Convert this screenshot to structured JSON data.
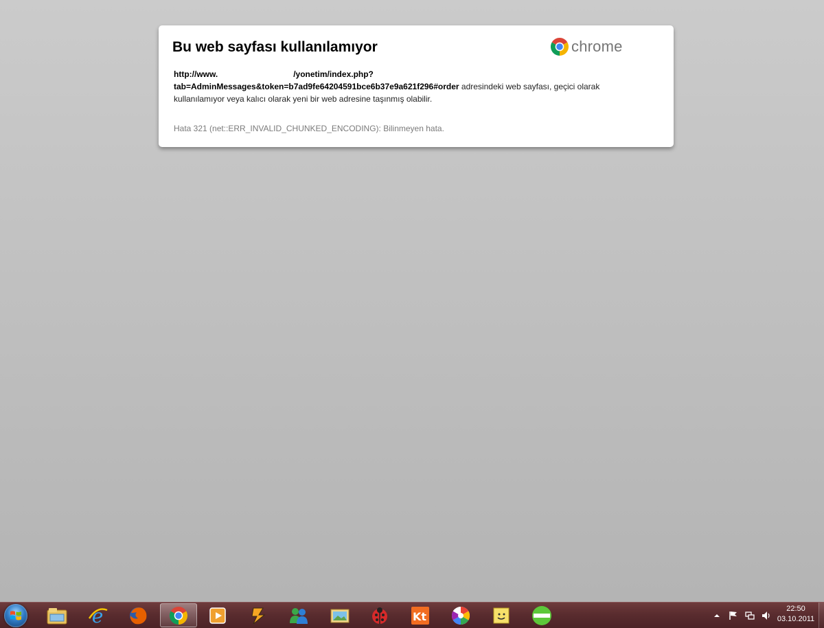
{
  "error_page": {
    "title": "Bu web sayfası kullanılamıyor",
    "brand": "chrome",
    "url_part1": "http://www.",
    "url_part2": "/yonetim/index.php?",
    "url_part3": "tab=AdminMessages&token=b7ad9fe64204591bce6b37e9a621f296#order",
    "message_tail1": " adresindeki web sayfası, geçici olarak",
    "message_tail2": "kullanılamıyor veya kalıcı olarak yeni bir web adresine taşınmış olabilir.",
    "error_code": "Hata 321 (net::ERR_INVALID_CHUNKED_ENCODING): Bilinmeyen hata."
  },
  "taskbar": {
    "pinned": [
      "windows-explorer",
      "internet-explorer",
      "firefox",
      "chrome",
      "media-player",
      "winamp",
      "messenger",
      "photo-viewer",
      "ladybug-app",
      "kt-app",
      "picasa",
      "sticky-notes",
      "green-app"
    ],
    "active": "chrome",
    "tray_icons": [
      "show-hidden-icons",
      "action-center-flag",
      "network",
      "volume"
    ],
    "clock_time": "22:50",
    "clock_date": "03.10.2011"
  },
  "colors": {
    "accent_chrome_red": "#db4437",
    "accent_chrome_green": "#0f9d58",
    "accent_chrome_yellow": "#f4b400",
    "accent_chrome_blue": "#4285f4",
    "taskbar": "#5a2c2f"
  }
}
